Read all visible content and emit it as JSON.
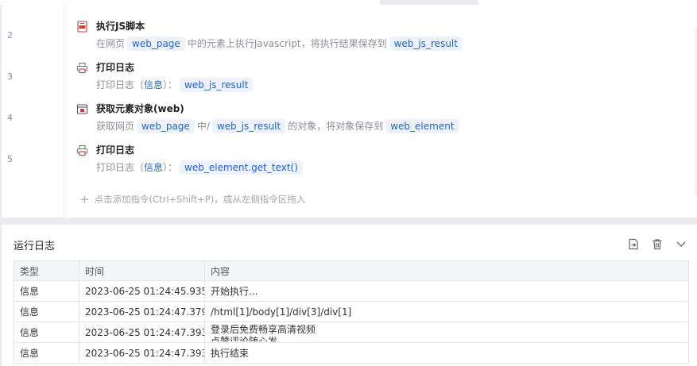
{
  "editor": {
    "steps": [
      {
        "line": "2",
        "icon": "js-script-icon",
        "title": "执行JS脚本",
        "desc": [
          {
            "type": "text",
            "value": "在网页"
          },
          {
            "type": "tag",
            "value": "web_page"
          },
          {
            "type": "text",
            "value": "中的元素上执行Javascript，将执行结果保存到"
          },
          {
            "type": "tag",
            "value": "web_js_result"
          }
        ]
      },
      {
        "line": "3",
        "icon": "printer-icon",
        "title": "打印日志",
        "desc": [
          {
            "type": "text",
            "value": "打印日志（"
          },
          {
            "type": "kw",
            "value": "信息"
          },
          {
            "type": "text",
            "value": "）："
          },
          {
            "type": "tag",
            "value": "web_js_result"
          }
        ]
      },
      {
        "line": "4",
        "icon": "web-element-icon",
        "title": "获取元素对象(web)",
        "desc": [
          {
            "type": "text",
            "value": "获取网页"
          },
          {
            "type": "tag",
            "value": "web_page"
          },
          {
            "type": "text",
            "value": "中/"
          },
          {
            "type": "tag",
            "value": "web_js_result"
          },
          {
            "type": "text",
            "value": "的对象，将对象保存到"
          },
          {
            "type": "tag",
            "value": "web_element"
          }
        ]
      },
      {
        "line": "5",
        "icon": "printer-icon",
        "title": "打印日志",
        "desc": [
          {
            "type": "text",
            "value": "打印日志（"
          },
          {
            "type": "kw",
            "value": "信息"
          },
          {
            "type": "text",
            "value": "）："
          },
          {
            "type": "tag",
            "value": "web_element.get_text()"
          }
        ]
      }
    ],
    "add_hint": "点击添加指令(Ctrl+Shift+P)，或从左侧指令区拖入"
  },
  "log": {
    "title": "运行日志",
    "actions": [
      "export-icon",
      "trash-icon",
      "chevron-down-icon"
    ],
    "columns": [
      "类型",
      "时间",
      "内容"
    ],
    "rows": [
      {
        "type": "信息",
        "time": "2023-06-25 01:24:45.935",
        "content": "开始执行..."
      },
      {
        "type": "信息",
        "time": "2023-06-25 01:24:47.379",
        "content": "/html[1]/body[1]/div[3]/div[1]"
      },
      {
        "type": "信息",
        "time": "2023-06-25 01:24:47.393",
        "content": "登录后免费畅享高清视频",
        "content_line2": "点赞评论随心发"
      },
      {
        "type": "信息",
        "time": "2023-06-25 01:24:47.393",
        "content": "执行结束"
      }
    ]
  },
  "colors": {
    "accent": "#1f63d8",
    "tag_bg": "#eef3fb",
    "muted": "#8c8f96",
    "icon_red": "#d9363e"
  }
}
